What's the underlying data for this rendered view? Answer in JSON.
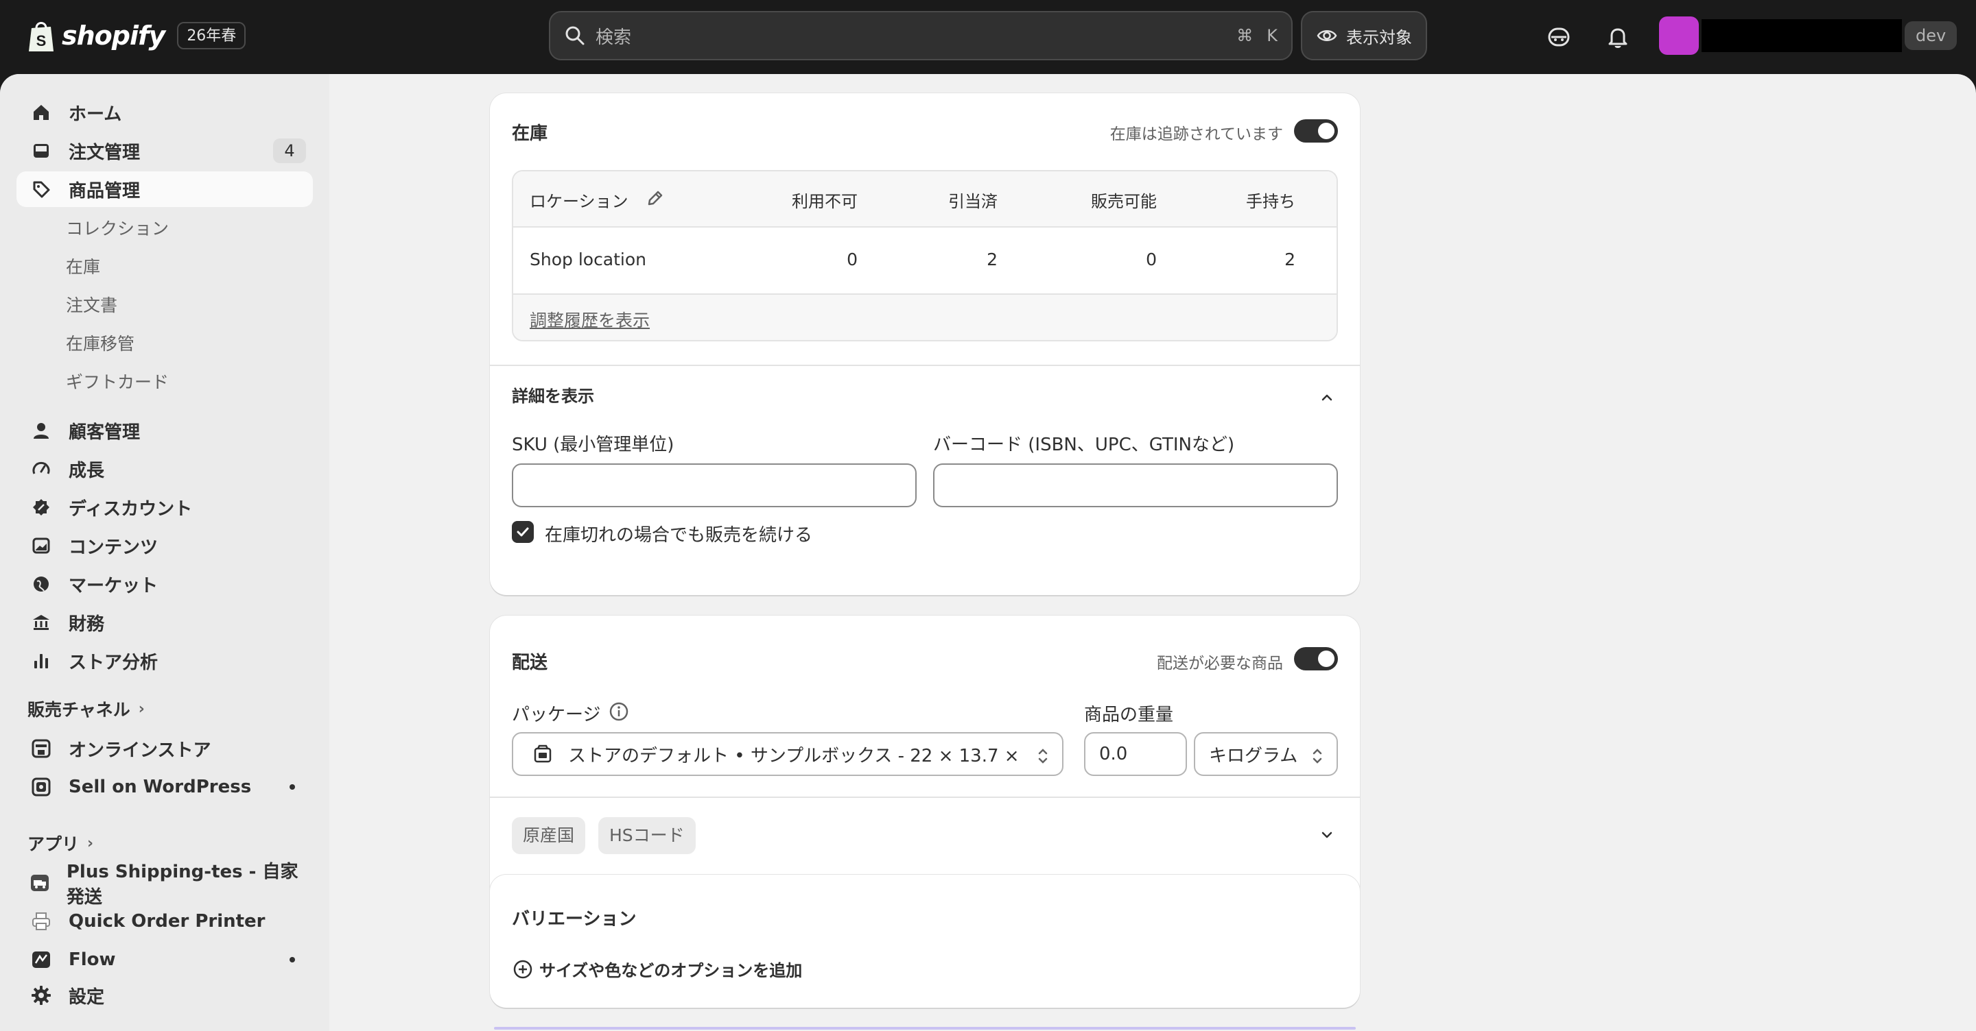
{
  "topbar": {
    "logo_text": "shopify",
    "edition": "26年春",
    "search_placeholder": "検索",
    "search_shortcut_cmd": "⌘",
    "search_shortcut_key": "K",
    "viewers_label": "表示対象",
    "dev_label": "dev",
    "avatar_color": "#c138cf"
  },
  "sidebar": {
    "main_items": [
      {
        "label": "ホーム",
        "icon": "home-icon"
      },
      {
        "label": "注文管理",
        "icon": "inbox-icon",
        "badge": "4"
      },
      {
        "label": "商品管理",
        "icon": "tag-icon",
        "active": true
      }
    ],
    "product_sub_items": [
      "コレクション",
      "在庫",
      "注文書",
      "在庫移管",
      "ギフトカード"
    ],
    "more_items": [
      {
        "label": "顧客管理",
        "icon": "person-icon"
      },
      {
        "label": "成長",
        "icon": "gauge-icon"
      },
      {
        "label": "ディスカウント",
        "icon": "discount-icon"
      },
      {
        "label": "コンテンツ",
        "icon": "image-icon"
      },
      {
        "label": "マーケット",
        "icon": "globe-icon"
      },
      {
        "label": "財務",
        "icon": "bank-icon"
      },
      {
        "label": "ストア分析",
        "icon": "bar-chart-icon"
      }
    ],
    "sales_channels_heading": "販売チャネル",
    "sales_channels": [
      {
        "label": "オンラインストア",
        "icon": "store-icon"
      },
      {
        "label": "Sell on WordPress",
        "icon": "app-icon"
      }
    ],
    "apps_heading": "アプリ",
    "apps": [
      {
        "label": "Plus Shipping-tes - 自家発送",
        "icon": "truck-app-icon"
      },
      {
        "label": "Quick Order Printer",
        "icon": "printer-app-icon"
      },
      {
        "label": "Flow",
        "icon": "flow-app-icon"
      }
    ],
    "settings_label": "設定"
  },
  "inventory": {
    "title": "在庫",
    "tracking_label": "在庫は追跡されています",
    "tracking_on": true,
    "columns": [
      "ロケーション",
      "利用不可",
      "引当済",
      "販売可能",
      "手持ち"
    ],
    "rows": [
      {
        "location": "Shop location",
        "unavailable": "0",
        "committed": "2",
        "available": "0",
        "on_hand": "2"
      }
    ],
    "history_link": "調整履歴を表示",
    "details_toggle": "詳細を表示",
    "sku_label": "SKU (最小管理単位)",
    "sku_value": "",
    "barcode_label": "バーコード (ISBN、UPC、GTINなど)",
    "barcode_value": "",
    "continue_selling_label": "在庫切れの場合でも販売を続ける",
    "continue_selling_checked": true
  },
  "shipping": {
    "title": "配送",
    "physical_label": "配送が必要な商品",
    "physical_on": true,
    "package_label": "パッケージ",
    "package_value": "ストアのデフォルト • サンプルボックス - 22 × 13.7 ×",
    "weight_label": "商品の重量",
    "weight_value": "0.0",
    "weight_unit": "キログラム",
    "chips": [
      "原産国",
      "HSコード"
    ]
  },
  "variants": {
    "title": "バリエーション",
    "add_option_label": "サイズや色などのオプションを追加"
  }
}
